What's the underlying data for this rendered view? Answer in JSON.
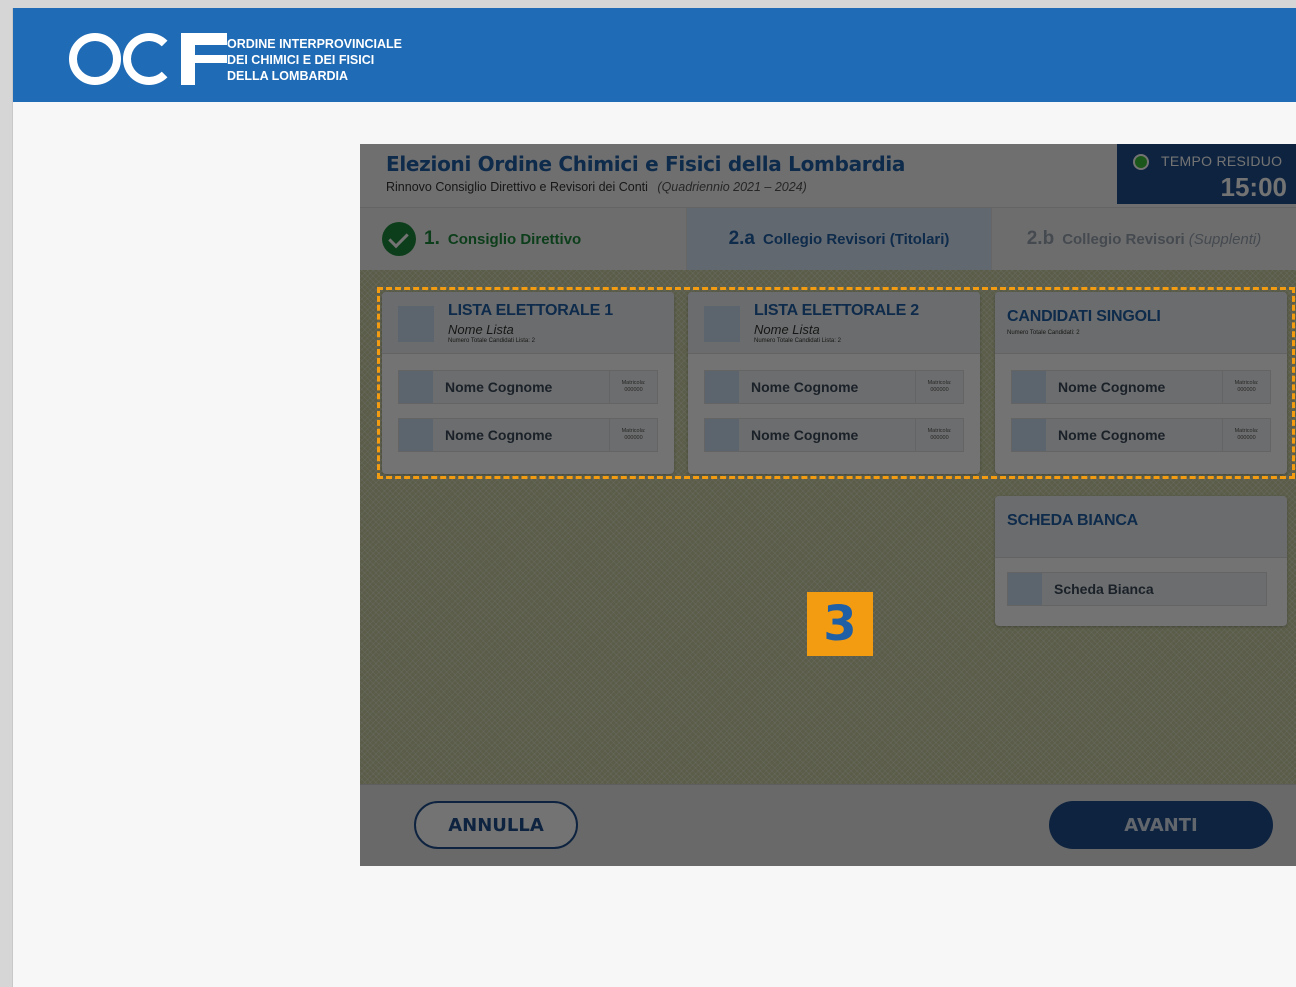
{
  "brand": {
    "logo_text": "OCF",
    "org_lines": [
      "ORDINE INTERPROVINCIALE",
      "DEI CHIMICI E DEI FISICI",
      "DELLA LOMBARDIA"
    ]
  },
  "app": {
    "title": "Elezioni Ordine Chimici e Fisici della Lombardia",
    "subtitle": "Rinnovo Consiglio Direttivo e Revisori dei Conti",
    "period": "(Quadriennio 2021 – 2024)"
  },
  "timer": {
    "label": "TEMPO RESIDUO",
    "value": "15:00",
    "status_color": "#3cc23a"
  },
  "steps": [
    {
      "num": "1.",
      "label": "Consiglio Direttivo",
      "state": "done"
    },
    {
      "num": "2.a",
      "label": "Collegio Revisori (Titolari)",
      "state": "active"
    },
    {
      "num": "2.b",
      "label": "Collegio Revisori",
      "label_muted": "(Supplenti)",
      "state": "future"
    }
  ],
  "lists": [
    {
      "title": "LISTA ELETTORALE 1",
      "subtitle": "Nome Lista",
      "count_text": "Numero Totale Candidati Lista: 2",
      "candidates": [
        {
          "name": "Nome Cognome",
          "mat_label": "Matricola:",
          "mat_value": "000000"
        },
        {
          "name": "Nome Cognome",
          "mat_label": "Matricola:",
          "mat_value": "000000"
        }
      ]
    },
    {
      "title": "LISTA ELETTORALE 2",
      "subtitle": "Nome Lista",
      "count_text": "Numero Totale Candidati Lista: 2",
      "candidates": [
        {
          "name": "Nome Cognome",
          "mat_label": "Matricola:",
          "mat_value": "000000"
        },
        {
          "name": "Nome Cognome",
          "mat_label": "Matricola:",
          "mat_value": "000000"
        }
      ]
    },
    {
      "title": "CANDIDATI SINGOLI",
      "count_text": "Numero Totale Candidati: 2",
      "candidates": [
        {
          "name": "Nome Cognome",
          "mat_label": "Matricola:",
          "mat_value": "000000"
        },
        {
          "name": "Nome Cognome",
          "mat_label": "Matricola:",
          "mat_value": "000000"
        }
      ]
    }
  ],
  "blank_ballot": {
    "title": "SCHEDA BIANCA",
    "option": "Scheda Bianca"
  },
  "overlay": {
    "step_number": "3",
    "highlight_color": "#f39c12"
  },
  "buttons": {
    "cancel": "ANNULLA",
    "next": "AVANTI"
  },
  "colors": {
    "brand_blue": "#1f6bb5",
    "primary": "#1f4f8c",
    "done_green": "#1e8a3c"
  }
}
